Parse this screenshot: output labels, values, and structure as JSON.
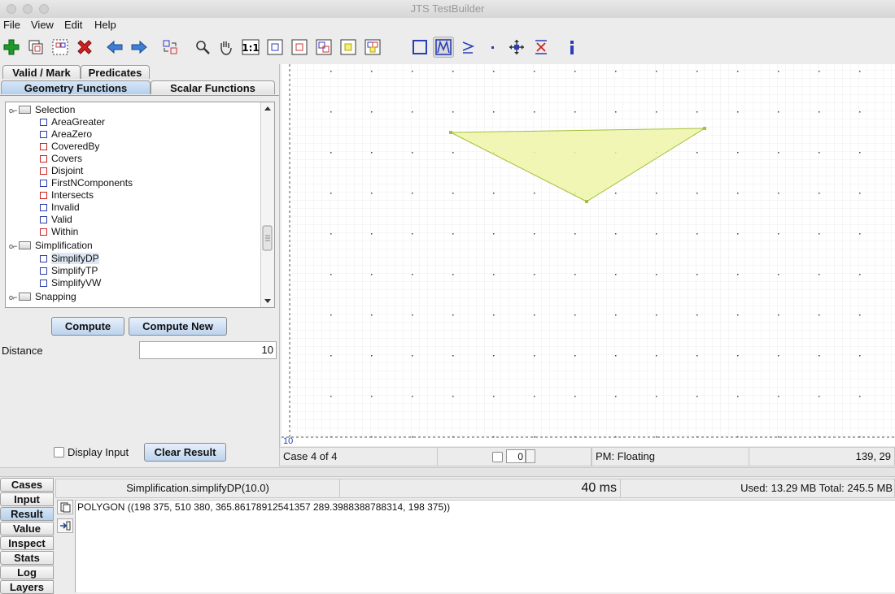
{
  "window": {
    "title": "JTS TestBuilder"
  },
  "menu": [
    "File",
    "View",
    "Edit",
    "Help"
  ],
  "left": {
    "tabs_back": [
      "Valid / Mark",
      "Predicates"
    ],
    "tabs_front": [
      "Geometry Functions",
      "Scalar Functions"
    ],
    "tree": [
      {
        "label": "Selection",
        "kind": "folder"
      },
      {
        "label": "AreaGreater",
        "kind": "unary"
      },
      {
        "label": "AreaZero",
        "kind": "unary"
      },
      {
        "label": "CoveredBy",
        "kind": "binary"
      },
      {
        "label": "Covers",
        "kind": "binary"
      },
      {
        "label": "Disjoint",
        "kind": "binary"
      },
      {
        "label": "FirstNComponents",
        "kind": "unary"
      },
      {
        "label": "Intersects",
        "kind": "binary"
      },
      {
        "label": "Invalid",
        "kind": "unary"
      },
      {
        "label": "Valid",
        "kind": "unary"
      },
      {
        "label": "Within",
        "kind": "binary"
      },
      {
        "label": "Simplification",
        "kind": "folder"
      },
      {
        "label": "SimplifyDP",
        "kind": "unary",
        "selected": true
      },
      {
        "label": "SimplifyTP",
        "kind": "unary"
      },
      {
        "label": "SimplifyVW",
        "kind": "unary"
      },
      {
        "label": "Snapping",
        "kind": "folder"
      }
    ],
    "compute_label": "Compute",
    "compute_new_label": "Compute New",
    "param_label": "Distance",
    "param_value": "10",
    "display_input_label": "Display Input",
    "clear_result_label": "Clear Result"
  },
  "canvas": {
    "scale_label": "10",
    "fill_color": "#f0f5a8",
    "stroke_color": "#a5bf3c"
  },
  "status": {
    "case_label": "Case 4 of 4",
    "spinner_value": "0",
    "precision_model": "PM: Floating",
    "coords": "139, 29"
  },
  "bottom": {
    "tabs": [
      "Cases",
      "Input",
      "Result",
      "Value",
      "Inspect",
      "Stats",
      "Log",
      "Layers"
    ],
    "selected_tab": "Result",
    "function_call": "Simplification.simplifyDP(10.0)",
    "time": "40 ms",
    "memory": "Used: 13.29 MB    Total: 245.5 MB",
    "result_wkt": "POLYGON ((198 375, 510 380, 365.86178912541357 289.3988388788314, 198 375))"
  }
}
